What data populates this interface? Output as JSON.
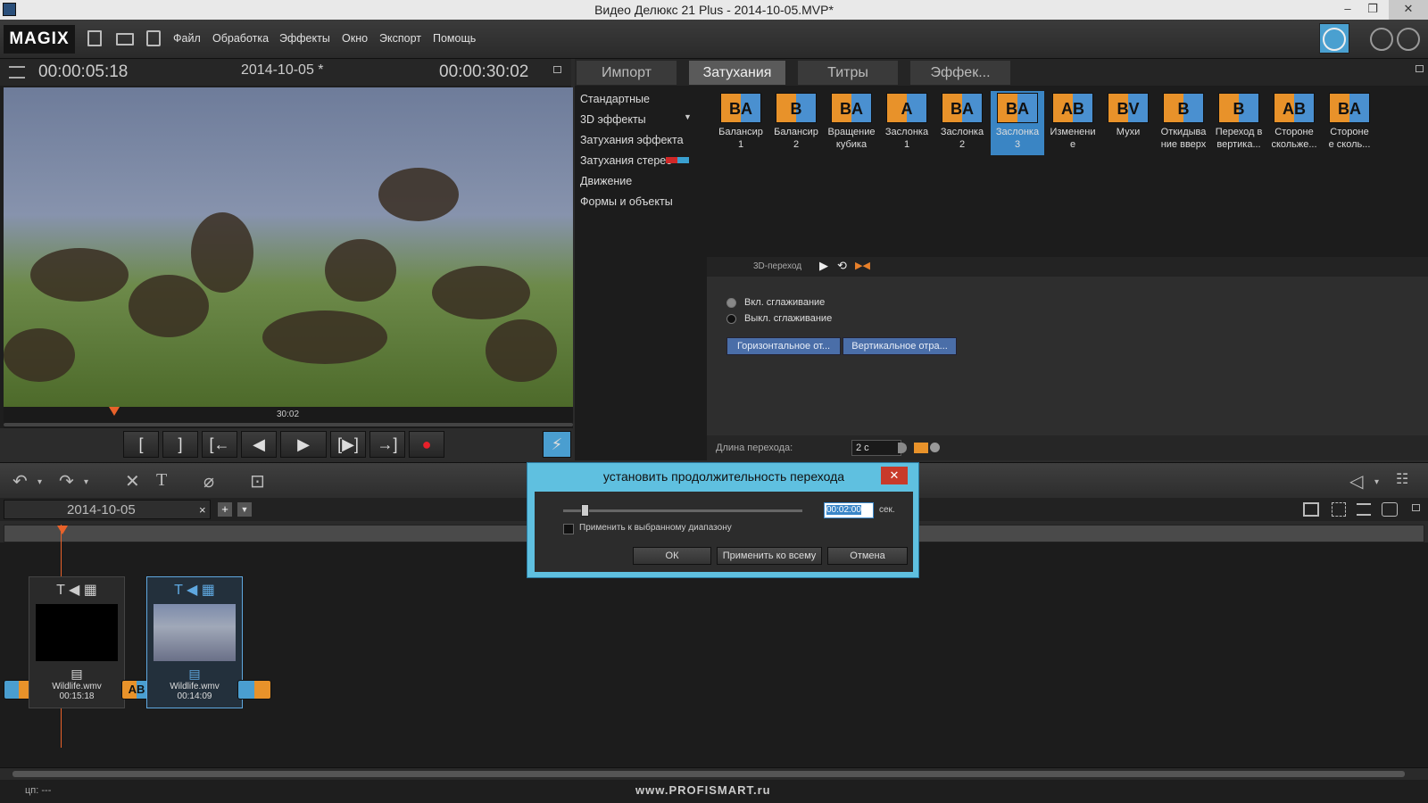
{
  "window": {
    "title": "Видео Делюкс 21 Plus - 2014-10-05.MVP*",
    "minimize": "–",
    "maximize": "❐",
    "close": "✕"
  },
  "menubar": {
    "logo": "MAGIX",
    "items": [
      "Файл",
      "Обработка",
      "Эффекты",
      "Окно",
      "Экспорт",
      "Помощь"
    ]
  },
  "preview": {
    "time_current": "00:00:05:18",
    "project": "2014-10-05 *",
    "time_total": "00:00:30:02",
    "scrub_label": "30:02"
  },
  "transport": {
    "mark_in": "[",
    "mark_out": "]",
    "to_start": "[←",
    "prev": "◀",
    "play": "▶",
    "next": "[▶]",
    "to_end": "→]",
    "record": "●",
    "lightning": "⚡"
  },
  "tabs": [
    "Импорт",
    "Затухания",
    "Титры",
    "Эффек..."
  ],
  "categories": [
    "Стандартные",
    "3D эффекты",
    "Затухания эффекта",
    "Затухания стерео",
    "Движение",
    "Формы и объекты"
  ],
  "transitions": [
    {
      "l1": "Балансир",
      "l2": "1",
      "a": "B",
      "b": "A"
    },
    {
      "l1": "Балансир",
      "l2": "2",
      "a": "B",
      "b": ""
    },
    {
      "l1": "Вращение",
      "l2": "кубика",
      "a": "B",
      "b": "A"
    },
    {
      "l1": "Заслонка",
      "l2": "1",
      "a": "A",
      "b": ""
    },
    {
      "l1": "Заслонка",
      "l2": "2",
      "a": "B",
      "b": "A"
    },
    {
      "l1": "Заслонка",
      "l2": "3",
      "a": "B",
      "b": "A"
    },
    {
      "l1": "Изменени",
      "l2": "е",
      "a": "A",
      "b": "B"
    },
    {
      "l1": "Мухи",
      "l2": "",
      "a": "B",
      "b": "V"
    },
    {
      "l1": "Откидыва",
      "l2": "ние вверх",
      "a": "B",
      "b": ""
    },
    {
      "l1": "Переход в",
      "l2": "вертика...",
      "a": "B",
      "b": ""
    },
    {
      "l1": "Стороне",
      "l2": "скольже...",
      "a": "A",
      "b": "B"
    },
    {
      "l1": "Стороне",
      "l2": "е сколь...",
      "a": "B",
      "b": "A"
    }
  ],
  "props": {
    "mode_label": "3D-переход",
    "radio1": "Вкл. сглаживание",
    "radio2": "Выкл. сглаживание",
    "btn_h": "Горизонтальное от...",
    "btn_v": "Вертикальное отра...",
    "len_label": "Длина перехода:",
    "len_value": "2 с"
  },
  "timeline": {
    "project_tab": "2014-10-05",
    "clips": [
      {
        "name": "Wildlife.wmv",
        "duration": "00:15:18"
      },
      {
        "name": "Wildlife.wmv",
        "duration": "00:14:09"
      }
    ]
  },
  "dialog": {
    "title": "установить продолжительность перехода",
    "value": "00:02:00",
    "unit": "сек.",
    "checkbox": "Применить к выбранному диапазону",
    "ok": "ОК",
    "apply_all": "Применить ко всему",
    "cancel": "Отмена"
  },
  "status": {
    "left": "цп: ---",
    "center": "www.PROFISMART.ru"
  }
}
